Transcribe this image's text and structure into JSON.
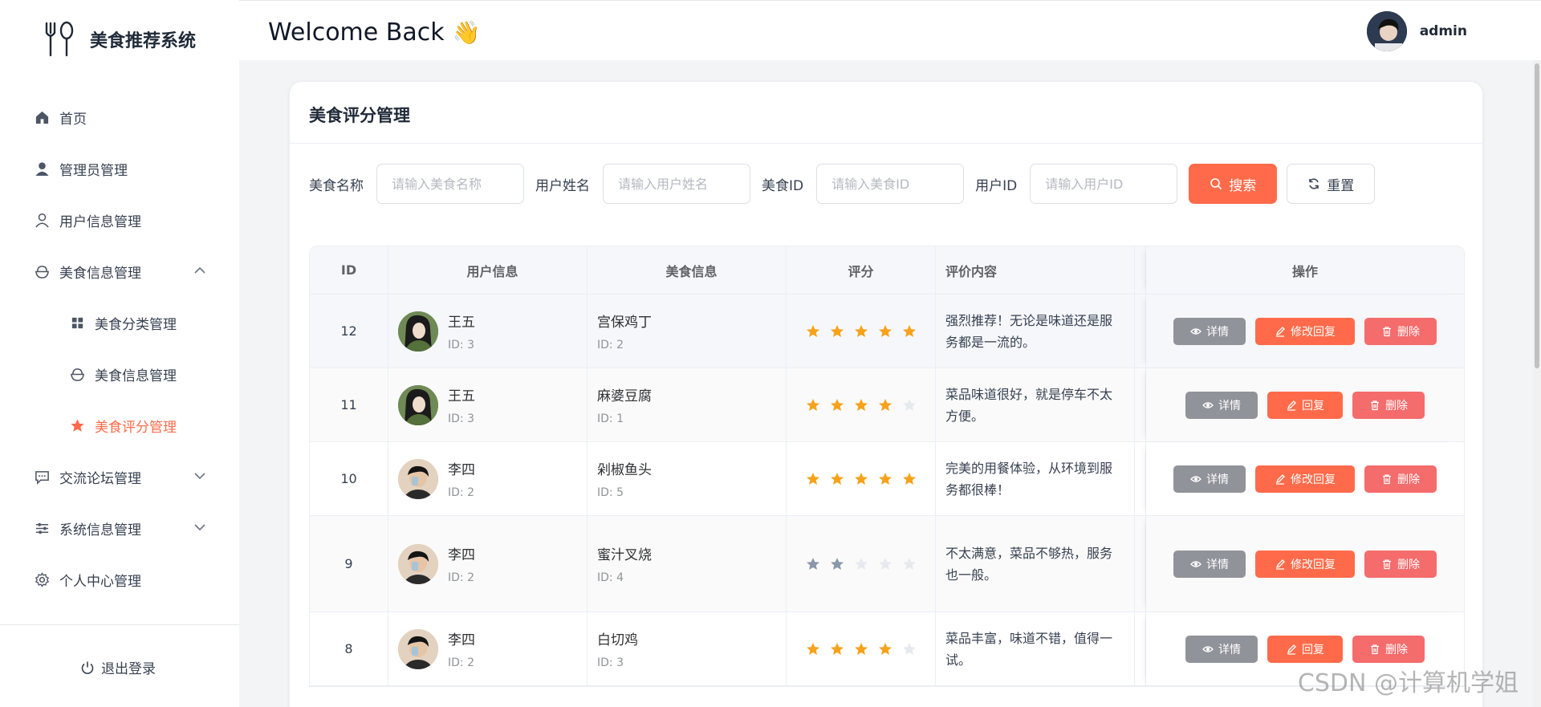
{
  "app": {
    "title": "美食推荐系统"
  },
  "sidebar": {
    "items": [
      {
        "label": "首页"
      },
      {
        "label": "管理员管理"
      },
      {
        "label": "用户信息管理"
      },
      {
        "label": "美食信息管理"
      },
      {
        "label": "美食分类管理"
      },
      {
        "label": "美食信息管理"
      },
      {
        "label": "美食评分管理"
      },
      {
        "label": "交流论坛管理"
      },
      {
        "label": "系统信息管理"
      },
      {
        "label": "个人中心管理"
      }
    ],
    "logout": "退出登录"
  },
  "header": {
    "welcome": "Welcome Back",
    "wave": "👋",
    "username": "admin"
  },
  "page": {
    "title": "美食评分管理"
  },
  "search": {
    "food_name_label": "美食名称",
    "food_name_placeholder": "请输入美食名称",
    "user_name_label": "用户姓名",
    "user_name_placeholder": "请输入用户姓名",
    "food_id_label": "美食ID",
    "food_id_placeholder": "请输入美食ID",
    "user_id_label": "用户ID",
    "user_id_placeholder": "请输入用户ID",
    "search_label": "搜索",
    "reset_label": "重置"
  },
  "table": {
    "headers": {
      "id": "ID",
      "user": "用户信息",
      "food": "美食信息",
      "rating": "评分",
      "content": "评价内容",
      "actions": "操作"
    },
    "rows": [
      {
        "id": "12",
        "user_name": "王五",
        "user_id": "ID: 3",
        "food_name": "宫保鸡丁",
        "food_id": "ID: 2",
        "rating": 5,
        "content": "强烈推荐！无论是味道还是服务都是一流的。",
        "detail": "详情",
        "reply": "修改回复",
        "delete": "删除"
      },
      {
        "id": "11",
        "user_name": "王五",
        "user_id": "ID: 3",
        "food_name": "麻婆豆腐",
        "food_id": "ID: 1",
        "rating": 4,
        "content": "菜品味道很好，就是停车不太方便。",
        "detail": "详情",
        "reply": "回复",
        "delete": "删除"
      },
      {
        "id": "10",
        "user_name": "李四",
        "user_id": "ID: 2",
        "food_name": "剁椒鱼头",
        "food_id": "ID: 5",
        "rating": 5,
        "content": "完美的用餐体验，从环境到服务都很棒！",
        "detail": "详情",
        "reply": "修改回复",
        "delete": "删除"
      },
      {
        "id": "9",
        "user_name": "李四",
        "user_id": "ID: 2",
        "food_name": "蜜汁叉烧",
        "food_id": "ID: 4",
        "rating": 2,
        "content": "不太满意，菜品不够热，服务也一般。",
        "detail": "详情",
        "reply": "修改回复",
        "delete": "删除"
      },
      {
        "id": "8",
        "user_name": "李四",
        "user_id": "ID: 2",
        "food_name": "白切鸡",
        "food_id": "ID: 3",
        "rating": 4,
        "content": "菜品丰富，味道不错，值得一试。",
        "detail": "详情",
        "reply": "回复",
        "delete": "删除"
      }
    ]
  },
  "watermark": "CSDN @计算机学姐",
  "colors": {
    "accent": "#ff6b4a",
    "star_gold": "#f7a21b",
    "star_low": "#8a97aa",
    "star_empty": "#e6e9ee",
    "danger": "#f56c6c",
    "info": "#909399"
  }
}
